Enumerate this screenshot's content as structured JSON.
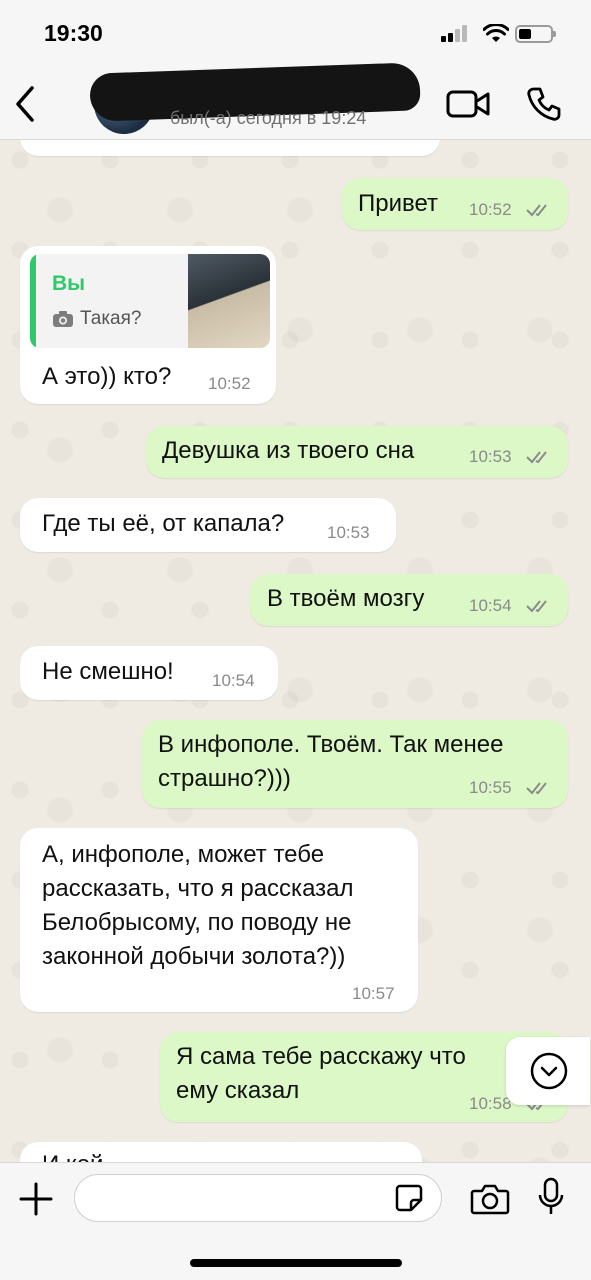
{
  "status_bar": {
    "time": "19:30"
  },
  "header": {
    "contact_status": "был(-а) сегодня в 19:24"
  },
  "quote": {
    "author": "Вы",
    "text": "Такая?"
  },
  "messages": [
    {
      "dir": "out",
      "text": "Привет",
      "time": "10:52"
    },
    {
      "dir": "in",
      "text": "А это)) кто?",
      "time": "10:52"
    },
    {
      "dir": "out",
      "text": "Девушка из твоего сна",
      "time": "10:53"
    },
    {
      "dir": "in",
      "text": "Где ты её, от капала?",
      "time": "10:53"
    },
    {
      "dir": "out",
      "text": "В твоём мозгу",
      "time": "10:54"
    },
    {
      "dir": "in",
      "text": "Не смешно!",
      "time": "10:54"
    },
    {
      "dir": "out",
      "text": "В инфополе. Твоём. Так менее\nстрашно?)))",
      "time": "10:55"
    },
    {
      "dir": "in",
      "text": "А, инфополе, может тебе\nрассказать, что я рассказал\nБелобрысому, по поводу не\nзаконной добычи золота?))",
      "time": "10:57"
    },
    {
      "dir": "out",
      "text": "Я сама тебе расскажу что\nему сказал",
      "time": "10:58"
    },
    {
      "dir": "in",
      "text": "И кой",
      "time": ""
    }
  ],
  "input": {
    "placeholder": ""
  },
  "colors": {
    "outgoing": "#dbf8c6",
    "incoming": "#ffffff",
    "accent": "#2fc96a",
    "read_ticks": "#8a8a8a"
  }
}
